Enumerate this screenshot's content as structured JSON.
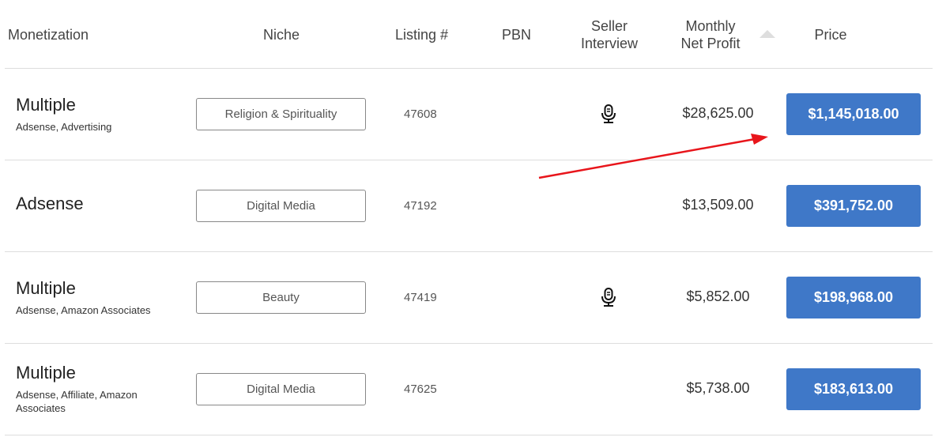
{
  "header": {
    "monetization": "Monetization",
    "niche": "Niche",
    "listing": "Listing #",
    "pbn": "PBN",
    "seller_interview_1": "Seller",
    "seller_interview_2": "Interview",
    "net_profit_1": "Monthly",
    "net_profit_2": "Net Profit",
    "price": "Price",
    "sort_icon": "sort-ascending-triangle"
  },
  "rows": [
    {
      "monetization": "Multiple",
      "sources": "Adsense, Advertising",
      "niche": "Religion & Spirituality",
      "listing": "47608",
      "seller_interview": true,
      "profit": "$28,625.00",
      "price": "$1,145,018.00"
    },
    {
      "monetization": "Adsense",
      "sources": "",
      "niche": "Digital Media",
      "listing": "47192",
      "seller_interview": false,
      "profit": "$13,509.00",
      "price": "$391,752.00"
    },
    {
      "monetization": "Multiple",
      "sources": "Adsense, Amazon Associates",
      "niche": "Beauty",
      "listing": "47419",
      "seller_interview": true,
      "profit": "$5,852.00",
      "price": "$198,968.00"
    },
    {
      "monetization": "Multiple",
      "sources": "Adsense, Affiliate, Amazon Associates",
      "niche": "Digital Media",
      "listing": "47625",
      "seller_interview": false,
      "profit": "$5,738.00",
      "price": "$183,613.00"
    }
  ],
  "annotation": {
    "type": "red-arrow",
    "color": "#e8151b",
    "points_to": "price of first row"
  },
  "colors": {
    "price_button": "#3f78c8",
    "divider": "#dddddd"
  }
}
